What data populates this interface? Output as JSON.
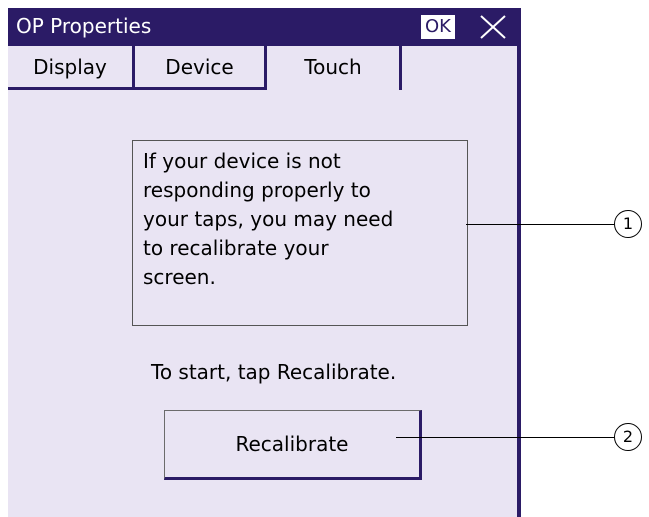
{
  "window": {
    "title": "OP Properties",
    "ok_label": "OK",
    "close_icon": "close-icon"
  },
  "tabs": [
    {
      "label": "Display"
    },
    {
      "label": "Device"
    },
    {
      "label": "Touch"
    }
  ],
  "touch": {
    "info_lines": [
      "If your device is not",
      "responding properly to",
      "your taps, you may need",
      "to recalibrate your",
      "screen."
    ],
    "start_text": "To start, tap Recalibrate.",
    "recalibrate_label": "Recalibrate"
  },
  "callouts": [
    "1",
    "2"
  ],
  "colors": {
    "titlebar": "#2b1b66",
    "background": "#e9e4f3"
  }
}
